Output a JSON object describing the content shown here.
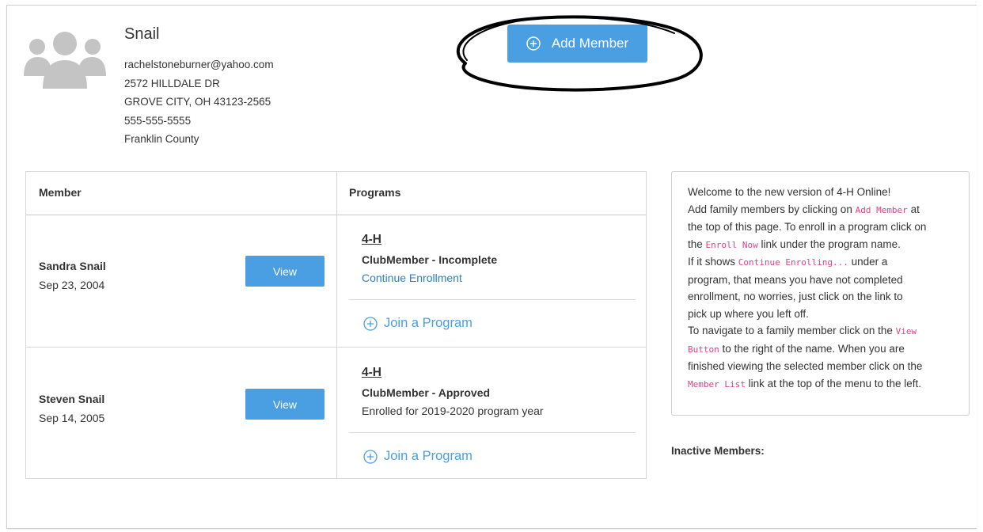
{
  "family": {
    "name": "Snail",
    "email": "rachelstoneburner@yahoo.com",
    "address1": "2572 HILLDALE DR",
    "address2": "GROVE CITY, OH 43123-2565",
    "phone": "555-555-5555",
    "county": "Franklin County"
  },
  "actions": {
    "add_member": "Add Member"
  },
  "table": {
    "headers": {
      "member": "Member",
      "programs": "Programs"
    },
    "rows": [
      {
        "name": "Sandra Snail",
        "dob": "Sep 23, 2004",
        "view": "View",
        "program": "4-H",
        "status": "ClubMember - Incomplete",
        "line3": "Continue Enrollment",
        "join": "Join a Program"
      },
      {
        "name": "Steven Snail",
        "dob": "Sep 14, 2005",
        "view": "View",
        "program": "4-H",
        "status": "ClubMember - Approved",
        "line3": "Enrolled for 2019-2020 program year",
        "join": "Join a Program"
      }
    ]
  },
  "help": {
    "l1": "Welcome to the new version of 4-H Online!",
    "l2a": "Add family members by clicking on ",
    "l2code": "Add Member",
    "l2b": " at",
    "l3": "the top of this page. To enroll in a program click on",
    "l4a": "the ",
    "l4code": "Enroll Now",
    "l4b": " link under the program name.",
    "l5a": "If it shows ",
    "l5code": "Continue Enrolling...",
    "l5b": " under a",
    "l6": "program, that means you have not completed",
    "l7": "enrollment, no worries, just click on the link to",
    "l8": "pick up where you left off.",
    "l9a": "To navigate to a family member click on the ",
    "l9code": "View",
    "l10code": "Button",
    "l10b": " to the right of the name. When you are",
    "l11": "finished viewing the selected member click on the",
    "l12code": "Member List",
    "l12b": " link at the top of the menu to the left."
  },
  "inactive_label": "Inactive Members:",
  "colors": {
    "accent": "#4a9fe2",
    "link": "#2f7ec4",
    "code": "#e0408a"
  },
  "icons": {
    "avatar": "family-group-icon",
    "add": "plus-circle-icon"
  }
}
